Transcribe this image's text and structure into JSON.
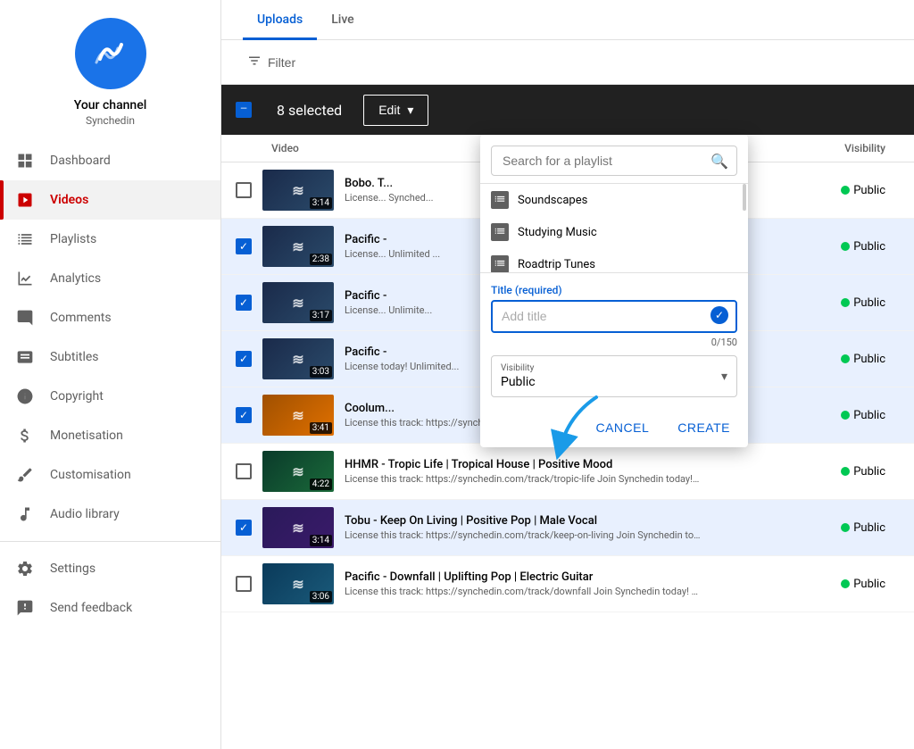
{
  "sidebar": {
    "channel_name": "Your channel",
    "channel_sub": "Synchedin",
    "items": [
      {
        "id": "dashboard",
        "label": "Dashboard",
        "icon": "grid-icon",
        "active": false
      },
      {
        "id": "videos",
        "label": "Videos",
        "icon": "play-icon",
        "active": true
      },
      {
        "id": "playlists",
        "label": "Playlists",
        "icon": "list-icon",
        "active": false
      },
      {
        "id": "analytics",
        "label": "Analytics",
        "icon": "analytics-icon",
        "active": false
      },
      {
        "id": "comments",
        "label": "Comments",
        "icon": "comment-icon",
        "active": false
      },
      {
        "id": "subtitles",
        "label": "Subtitles",
        "icon": "subtitles-icon",
        "active": false
      },
      {
        "id": "copyright",
        "label": "Copyright",
        "icon": "copyright-icon",
        "active": false
      },
      {
        "id": "monetisation",
        "label": "Monetisation",
        "icon": "money-icon",
        "active": false
      },
      {
        "id": "customisation",
        "label": "Customisation",
        "icon": "brush-icon",
        "active": false
      },
      {
        "id": "audio-library",
        "label": "Audio library",
        "icon": "audio-icon",
        "active": false
      }
    ],
    "footer_items": [
      {
        "id": "settings",
        "label": "Settings",
        "icon": "gear-icon"
      },
      {
        "id": "send-feedback",
        "label": "Send feedback",
        "icon": "feedback-icon"
      }
    ]
  },
  "main": {
    "tabs": [
      {
        "id": "uploads",
        "label": "Uploads",
        "active": true
      },
      {
        "id": "live",
        "label": "Live",
        "active": false
      }
    ],
    "filter_label": "Filter",
    "action_bar": {
      "selected_count": "8 selected",
      "edit_label": "Edit",
      "dropdown_arrow": "▾"
    },
    "table_header": {
      "video_col": "Video",
      "visibility_col": "Visibility"
    },
    "videos": [
      {
        "id": 1,
        "checked": false,
        "title": "Bobo. T...",
        "desc": "License... Synched...",
        "duration": "3:14",
        "visibility": "Public",
        "thumb_color": "#1a3a5c"
      },
      {
        "id": 2,
        "checked": true,
        "title": "Pacific -",
        "desc": "License... Unlimited ...",
        "duration": "2:38",
        "visibility": "Public",
        "thumb_color": "#1a3a5c"
      },
      {
        "id": 3,
        "checked": true,
        "title": "Pacific -",
        "desc": "License... Unlimite...",
        "duration": "3:17",
        "visibility": "Public",
        "thumb_color": "#1a3a5c"
      },
      {
        "id": 4,
        "checked": true,
        "title": "Pacific -",
        "desc": "License today! Unlimited...",
        "duration": "3:03",
        "visibility": "Public",
        "thumb_color": "#1a3a5c"
      },
      {
        "id": 5,
        "checked": true,
        "title": "Coolum...",
        "desc": "License this track: https://synchedin.com/track/white-sun Join Synchedin today! Unlimited Downloads! No Copyright Claims! Unlimited Commercial...",
        "duration": "3:41",
        "visibility": "Public",
        "thumb_color": "#e67e00"
      },
      {
        "id": 6,
        "checked": false,
        "title": "HHMR - Tropic Life | Tropical House | Positive Mood",
        "desc": "License this track: https://synchedin.com/track/tropic-life Join Synchedin today! Unlimited Downloads! No Copyright Claims! Unlimited Commercial...",
        "duration": "4:22",
        "visibility": "Public",
        "thumb_color": "#1a6a3a"
      },
      {
        "id": 7,
        "checked": true,
        "title": "Tobu - Keep On Living | Positive Pop | Male Vocal",
        "desc": "License this track: https://synchedin.com/track/keep-on-living Join Synchedin today! Unlimited Downloads! No Copyright Claims! Unlimited...",
        "duration": "3:14",
        "visibility": "Public",
        "thumb_color": "#3a1a6a"
      },
      {
        "id": 8,
        "checked": false,
        "title": "Pacific - Downfall | Uplifting Pop | Electric Guitar",
        "desc": "License this track: https://synchedin.com/track/downfall Join Synchedin today! Unlimited Downloads! No Copyright Claims! Unlimited Commercial...",
        "duration": "3:06",
        "visibility": "Public",
        "thumb_color": "#1a5a6a"
      }
    ]
  },
  "playlist_popup": {
    "search_placeholder": "Search for a playlist",
    "playlists": [
      {
        "id": 1,
        "name": "Soundscapes"
      },
      {
        "id": 2,
        "name": "Studying Music"
      },
      {
        "id": 3,
        "name": "Roadtrip Tunes"
      }
    ],
    "create_section": {
      "title_label": "Title (required)",
      "add_placeholder": "Add title",
      "char_count": "0/150",
      "visibility_label": "Visibility",
      "visibility_value": "Public"
    },
    "cancel_label": "CANCEL",
    "create_label": "CREATE"
  }
}
